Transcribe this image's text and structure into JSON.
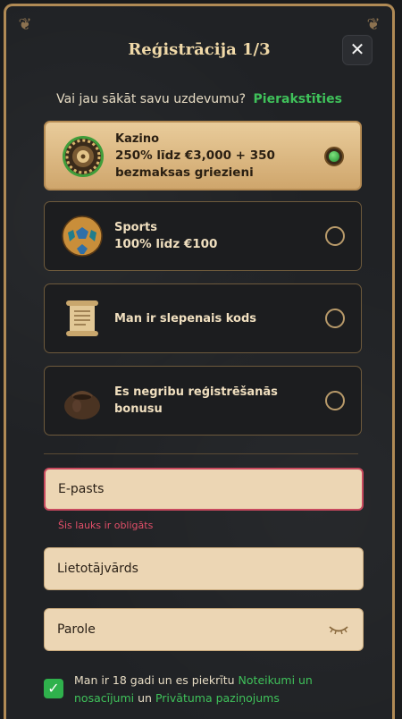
{
  "header": {
    "title": "Reģistrācija 1/3",
    "close_label": "✕"
  },
  "login": {
    "prompt": "Vai jau sākāt savu uzdevumu?",
    "link": "Pierakstīties"
  },
  "options": [
    {
      "line1": "Kazino",
      "line2": "250% līdz €3,000 + 350 bezmaksas griezieni",
      "icon": "roulette-icon",
      "selected": true
    },
    {
      "line1": "Sports",
      "line2": "100% līdz €100",
      "icon": "soccer-ball-icon",
      "selected": false
    },
    {
      "line1": "Man ir slepenais kods",
      "line2": "",
      "icon": "scroll-icon",
      "selected": false
    },
    {
      "line1": "Es negribu reģistrēšanās bonusu",
      "line2": "",
      "icon": "pouch-icon",
      "selected": false
    }
  ],
  "form": {
    "email_placeholder": "E-pasts",
    "email_error": "Šis lauks ir obligāts",
    "username_placeholder": "Lietotājvārds",
    "password_placeholder": "Parole"
  },
  "terms": {
    "prefix": "Man ir 18 gadi un es piekrītu",
    "terms_link": "Noteikumi un nosacījumi",
    "joiner": "un",
    "privacy_link": "Privātuma paziņojums",
    "checked": true
  },
  "colors": {
    "accent_green": "#3fc15a",
    "gold_border": "#b08a55",
    "error_red": "#e24f69"
  }
}
